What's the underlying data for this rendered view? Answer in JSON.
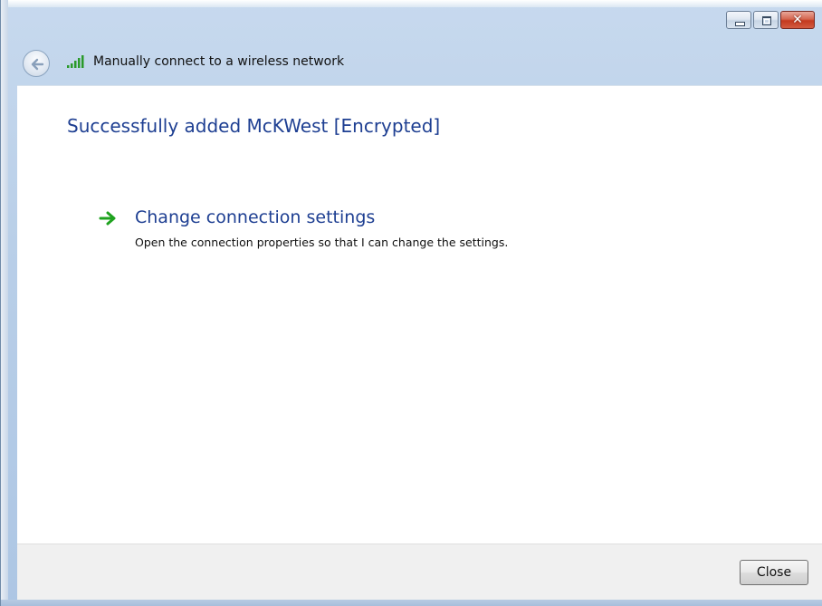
{
  "window": {
    "title": "Manually connect to a wireless network",
    "controls": {
      "minimize": "minimize-icon",
      "maximize": "maximize-icon",
      "close": "close-icon"
    }
  },
  "header": {
    "back_icon": "back-arrow-icon",
    "network_icon": "wireless-signal-icon",
    "title": "Manually connect to a wireless network"
  },
  "main": {
    "heading": "Successfully added McKWest [Encrypted]",
    "option": {
      "icon": "green-arrow-icon",
      "title": "Change connection settings",
      "description": "Open the connection properties so that I can change the settings."
    }
  },
  "footer": {
    "close_label": "Close"
  },
  "colors": {
    "heading": "#1e3f92",
    "accent_arrow": "#1fa21f"
  }
}
